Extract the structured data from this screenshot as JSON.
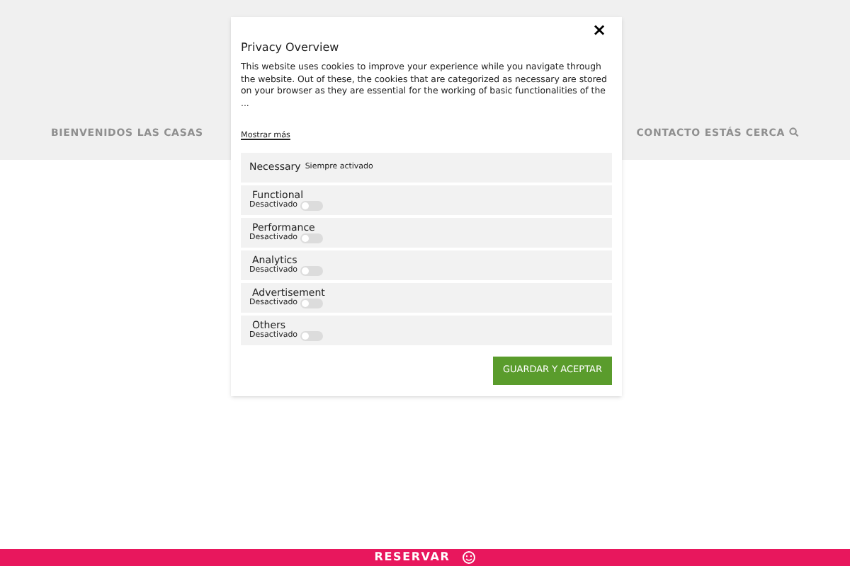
{
  "nav": {
    "items": [
      "BIENVENIDOS",
      "LAS CASAS",
      "CONTACTO",
      "ESTÁS CERCA"
    ]
  },
  "modal": {
    "title": "Privacy Overview",
    "close": "×",
    "description": "This website uses cookies to improve your experience while you navigate through the website. Out of these, the cookies that are categorized as necessary are stored on your browser as they are essential for the working of basic functionalities of the ...",
    "more_link": "Mostrar más",
    "categories": [
      {
        "kind": "fixed",
        "name": "Necessary",
        "status": "Siempre activado"
      },
      {
        "kind": "toggle",
        "name": "Functional",
        "status": "Desactivado",
        "enabled": false
      },
      {
        "kind": "toggle",
        "name": "Performance",
        "status": "Desactivado",
        "enabled": false
      },
      {
        "kind": "toggle",
        "name": "Analytics",
        "status": "Desactivado",
        "enabled": false
      },
      {
        "kind": "toggle",
        "name": "Advertisement",
        "status": "Desactivado",
        "enabled": false
      },
      {
        "kind": "toggle",
        "name": "Others",
        "status": "Desactivado",
        "enabled": false
      }
    ],
    "save_button": "GUARDAR Y ACEPTAR"
  },
  "footer_bar": {
    "label": "RESERVAR"
  }
}
